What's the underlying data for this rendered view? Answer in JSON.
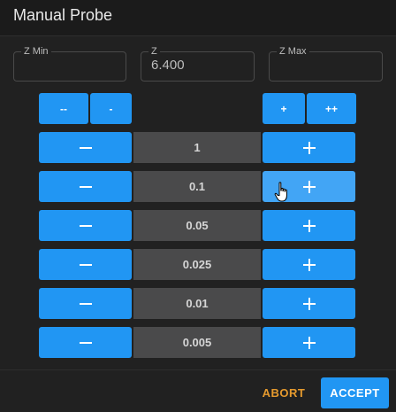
{
  "dialog": {
    "title": "Manual Probe"
  },
  "fields": {
    "z_min": {
      "label": "Z Min",
      "value": ""
    },
    "z": {
      "label": "Z",
      "value": "6.400"
    },
    "z_max": {
      "label": "Z Max",
      "value": ""
    }
  },
  "quick_buttons": {
    "big_down": "--",
    "small_down": "-",
    "small_up": "+",
    "big_up": "++"
  },
  "steps": [
    {
      "value": "1"
    },
    {
      "value": "0.1"
    },
    {
      "value": "0.05"
    },
    {
      "value": "0.025"
    },
    {
      "value": "0.01"
    },
    {
      "value": "0.005"
    }
  ],
  "footer": {
    "abort_label": "ABORT",
    "accept_label": "ACCEPT"
  },
  "colors": {
    "accent": "#2196f3",
    "abort": "#e69a2e",
    "background": "#212121",
    "step_value_bg": "#4a4a4b"
  },
  "icons": {
    "minus": "minus-icon",
    "plus": "plus-icon",
    "cursor": "hand-pointer-icon"
  }
}
